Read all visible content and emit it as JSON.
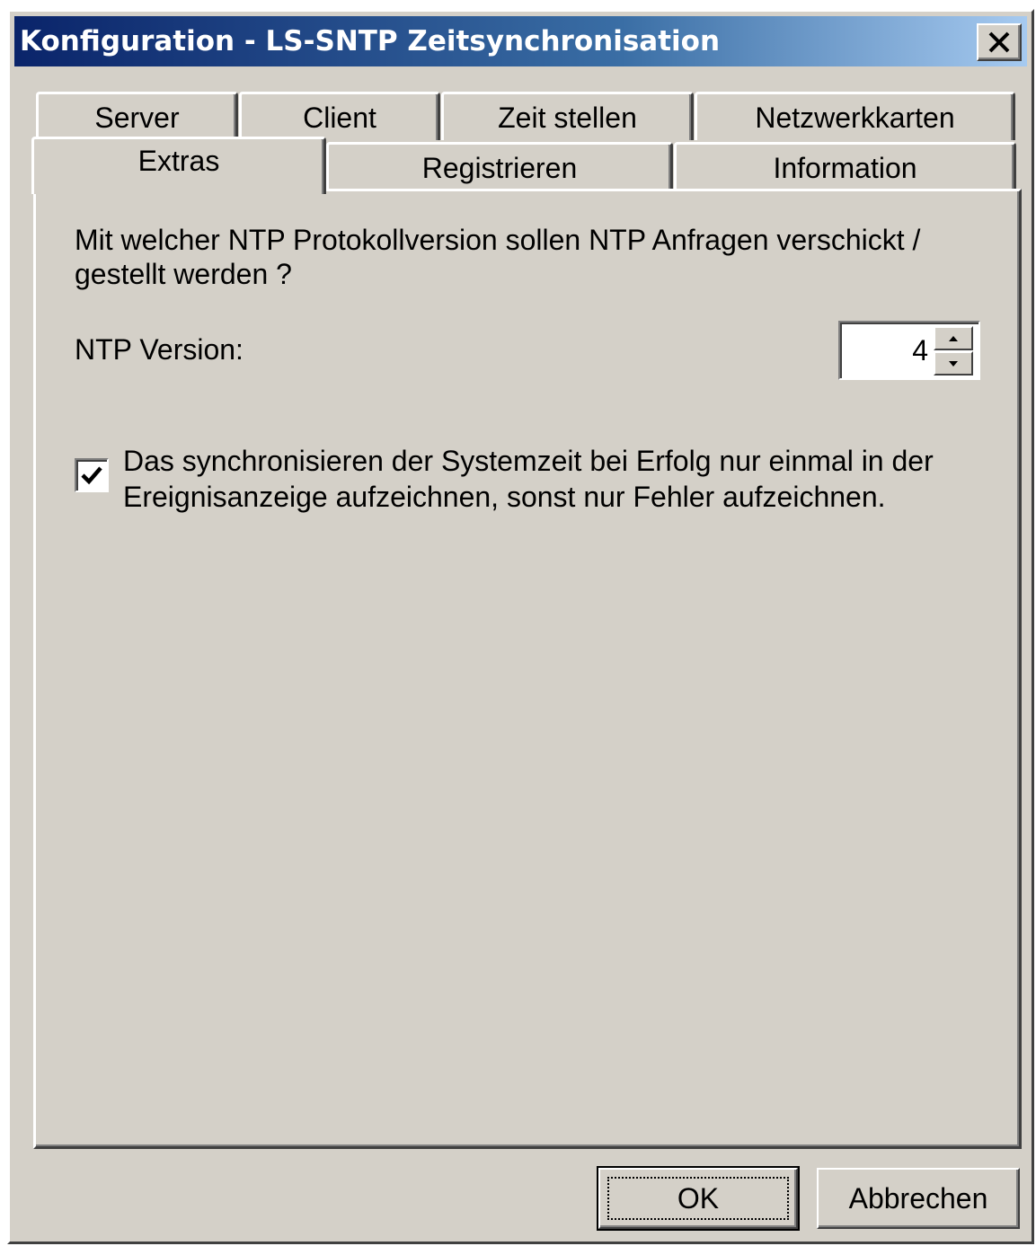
{
  "window": {
    "title": "Konfiguration - LS-SNTP Zeitsynchronisation",
    "close_label": "Close"
  },
  "tabs": {
    "row_back": [
      {
        "label": "Server"
      },
      {
        "label": "Client"
      },
      {
        "label": "Zeit stellen"
      },
      {
        "label": "Netzwerkkarten"
      }
    ],
    "row_front": [
      {
        "label": "Extras",
        "selected": true
      },
      {
        "label": "Registrieren"
      },
      {
        "label": "Information"
      }
    ]
  },
  "extras": {
    "question": "Mit welcher NTP Protokollversion sollen NTP Anfragen verschickt / gestellt werden ?",
    "ntp_version_label": "NTP Version:",
    "ntp_version_value": "4",
    "log_once_checked": true,
    "log_once_label": "Das synchronisieren der Systemzeit bei Erfolg nur einmal in der Ereignisanzeige aufzeichnen, sonst nur Fehler aufzeichnen."
  },
  "buttons": {
    "ok_label": "OK",
    "cancel_label": "Abbrechen"
  },
  "icons": {
    "close": "close-icon",
    "spin_up": "arrow-up-icon",
    "spin_down": "arrow-down-icon",
    "check": "checkmark-icon"
  },
  "colors": {
    "title_gradient_start": "#0a246a",
    "title_gradient_end": "#a6caf0",
    "face": "#d4d0c8"
  }
}
